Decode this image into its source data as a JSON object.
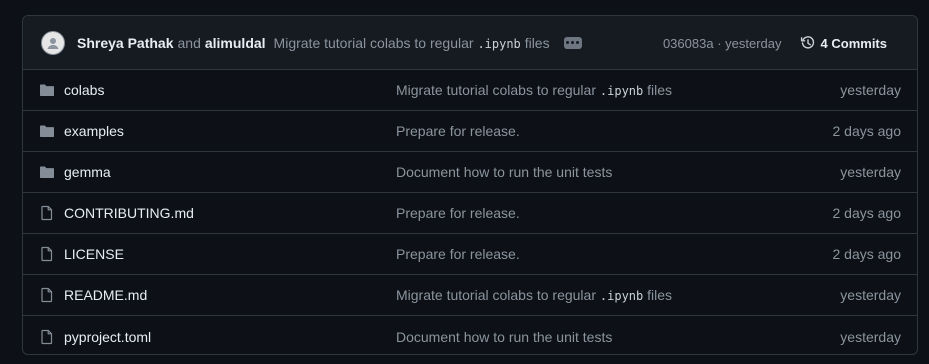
{
  "commit": {
    "author1": "Shreya Pathak",
    "and": "and",
    "author2": "alimuldal",
    "message_prefix": "Migrate tutorial colabs to regular",
    "message_code": ".ipynb",
    "message_suffix": "files",
    "sha": "036083a",
    "sep": "·",
    "when": "yesterday",
    "count_label": "4 Commits"
  },
  "icons": {
    "avatar": "avatar-icon",
    "ellipsis": "kebab-horizontal-icon",
    "history": "history-icon",
    "folder": "folder-icon",
    "file": "file-icon"
  },
  "colors": {
    "bg": "#0d1117",
    "header": "#161b22",
    "border": "#30363d",
    "muted": "#8b949e",
    "text": "#e6edf3"
  },
  "files": [
    {
      "name": "colabs",
      "type": "folder",
      "msg_prefix": "Migrate tutorial colabs to regular",
      "msg_code": ".ipynb",
      "msg_suffix": "files",
      "time": "yesterday"
    },
    {
      "name": "examples",
      "type": "folder",
      "msg_prefix": "Prepare for release.",
      "msg_code": "",
      "msg_suffix": "",
      "time": "2 days ago"
    },
    {
      "name": "gemma",
      "type": "folder",
      "msg_prefix": "Document how to run the unit tests",
      "msg_code": "",
      "msg_suffix": "",
      "time": "yesterday"
    },
    {
      "name": "CONTRIBUTING.md",
      "type": "file",
      "msg_prefix": "Prepare for release.",
      "msg_code": "",
      "msg_suffix": "",
      "time": "2 days ago"
    },
    {
      "name": "LICENSE",
      "type": "file",
      "msg_prefix": "Prepare for release.",
      "msg_code": "",
      "msg_suffix": "",
      "time": "2 days ago"
    },
    {
      "name": "README.md",
      "type": "file",
      "msg_prefix": "Migrate tutorial colabs to regular",
      "msg_code": ".ipynb",
      "msg_suffix": "files",
      "time": "yesterday"
    },
    {
      "name": "pyproject.toml",
      "type": "file",
      "msg_prefix": "Document how to run the unit tests",
      "msg_code": "",
      "msg_suffix": "",
      "time": "yesterday"
    }
  ]
}
